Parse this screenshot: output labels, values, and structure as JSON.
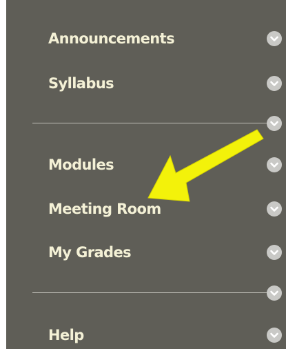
{
  "menu": {
    "items": [
      {
        "label": "Announcements",
        "icon": "chevron-down-icon"
      },
      {
        "label": "Syllabus",
        "icon": "chevron-down-icon"
      },
      {
        "label": "Modules",
        "icon": "chevron-down-icon"
      },
      {
        "label": "Meeting Room",
        "icon": "chevron-down-icon"
      },
      {
        "label": "My Grades",
        "icon": "chevron-down-icon"
      },
      {
        "label": "Help",
        "icon": "chevron-down-icon"
      }
    ]
  },
  "colors": {
    "menu_background": "#5f5e57",
    "label_text": "#f4f1d6",
    "chevron_circle": "#c9c9c6",
    "divider": "#c2c1ba",
    "annotation_arrow": "#f3f20a"
  },
  "annotation": {
    "icon": "arrow-icon",
    "points_to": "Meeting Room"
  }
}
